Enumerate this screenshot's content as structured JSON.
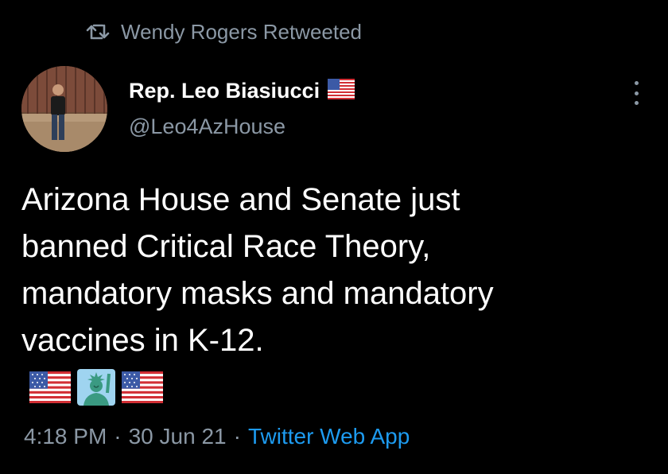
{
  "retweet": {
    "icon": "retweet-icon",
    "text": "Wendy Rogers Retweeted"
  },
  "author": {
    "display_name": "Rep. Leo Biasiucci",
    "name_emoji": "us-flag-icon",
    "handle": "@Leo4AzHouse"
  },
  "tweet": {
    "lines": [
      "Arizona House and Senate just",
      "banned Critical Race Theory,",
      "mandatory masks and mandatory",
      "vaccines in K-12."
    ],
    "emojis": [
      "us-flag-icon",
      "statue-of-liberty-icon",
      "us-flag-icon"
    ]
  },
  "meta": {
    "time": "4:18 PM",
    "separator": "·",
    "date": "30 Jun 21",
    "source": "Twitter Web App"
  },
  "colors": {
    "background": "#000000",
    "primary_text": "#ffffff",
    "secondary_text": "#8b98a5",
    "link": "#1d9bf0"
  }
}
